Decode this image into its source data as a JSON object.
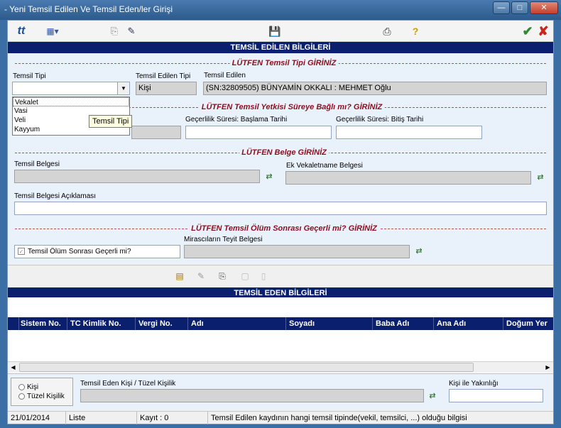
{
  "window": {
    "title": "- Yeni Temsil Edilen Ve Temsil Eden/ler Girişi",
    "minimize": "—",
    "maximize": "□",
    "close": "✕"
  },
  "toolbar": {
    "icons": [
      "app-logo-icon",
      "grid-menu-icon",
      "copy-icon",
      "edit-check-icon",
      "save-icon",
      "print-icon",
      "help-icon",
      "confirm-icon",
      "cancel-icon"
    ],
    "accent_confirm": "#2e8b2e",
    "accent_cancel": "#c8261a"
  },
  "section1": {
    "header": "TEMSİL EDİLEN BİLGİLERİ",
    "sep_type": "LÜTFEN Temsil Tipi GİRİNİZ",
    "temsil_tipi_label": "Temsil Tipi",
    "temsil_tipi_value": "",
    "dropdown_options": [
      "Vekalet",
      "Vasi",
      "Veli",
      "Kayyum"
    ],
    "tooltip": "Temsil Tipi",
    "edilen_tipi_label": "Temsil Edilen Tipi",
    "edilen_tipi_value": "Kişi",
    "edilen_label": "Temsil Edilen",
    "edilen_value": "(SN:32809505) BÜNYAMİN OKKALI : MEHMET Oğlu",
    "sep_sure": "LÜTFEN Temsil Yetkisi Süreye Bağlı mı? GİRİNİZ",
    "baslama_label": "Geçerlilik Süresi: Başlama Tarihi",
    "bitis_label": "Geçerlilik Süresi: Bitiş Tarihi",
    "sep_belge": "LÜTFEN Belge GİRİNİZ",
    "belge_label": "Temsil Belgesi",
    "ek_belge_label": "Ek Vekaletname Belgesi",
    "aciklama_label": "Temsil Belgesi Açıklaması",
    "sep_olum": "LÜTFEN Temsil Ölüm Sonrası Geçerli mi? GİRİNİZ",
    "olum_checkbox": "Temsil Ölüm Sonrası Geçerli mi?",
    "mirasci_label": "Mirascıların Teyit Belgesi"
  },
  "section2": {
    "header": "TEMSİL EDEN BİLGİLERİ",
    "columns": [
      "Sistem No.",
      "TC Kimlik No.",
      "Vergi No.",
      "Adı",
      "Soyadı",
      "Baba Adı",
      "Ana Adı",
      "Doğum Yer"
    ]
  },
  "bottom": {
    "radio_kisi": "Kişi",
    "radio_tuzel": "Tüzel Kişilik",
    "eden_label": "Temsil Eden Kişi / Tüzel Kişilik",
    "yakinlik_label": "Kişi ile Yakınlığı"
  },
  "status": {
    "date": "21/01/2014",
    "mode": "Liste",
    "count": "Kayıt : 0",
    "hint": "Temsil Edilen kaydının hangi temsil tipinde(vekil, temsilci, ...) olduğu bilgisi"
  }
}
